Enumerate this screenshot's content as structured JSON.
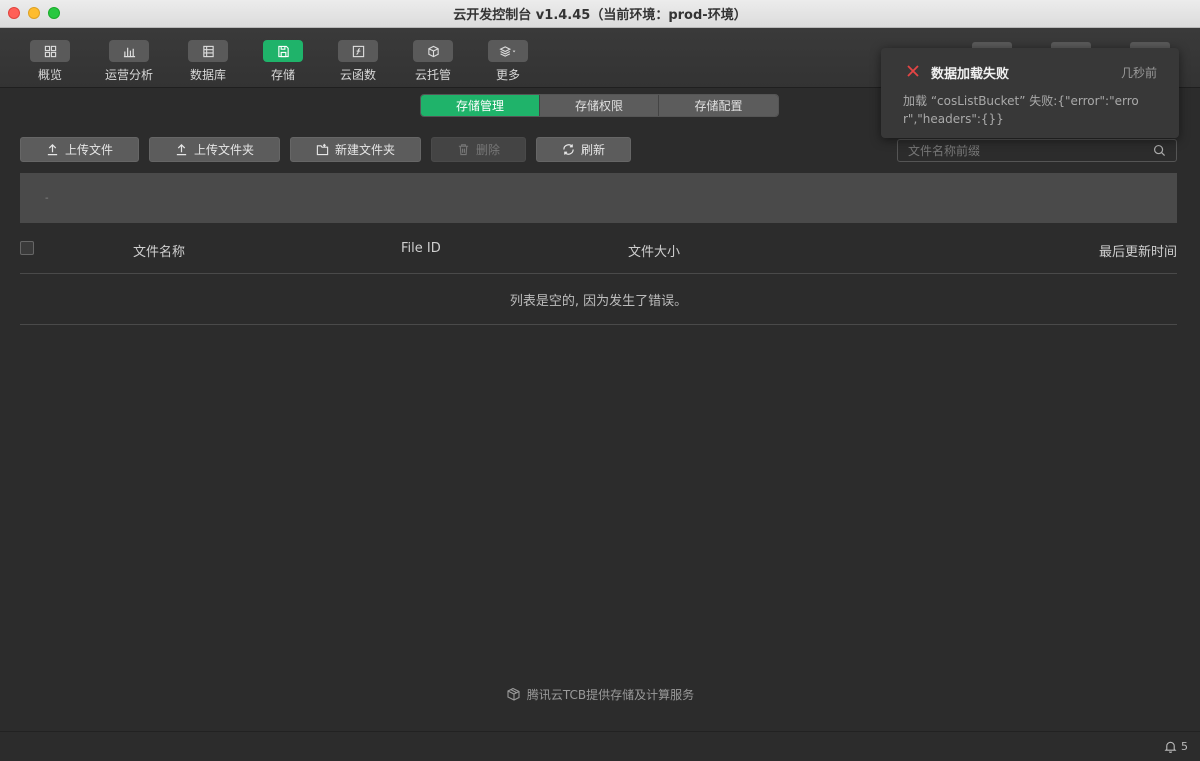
{
  "window": {
    "title": "云开发控制台 v1.4.45（当前环境：prod-环境）"
  },
  "toolbar": {
    "items": [
      {
        "label": "概览",
        "icon": "grid-icon"
      },
      {
        "label": "运营分析",
        "icon": "bar-chart-icon"
      },
      {
        "label": "数据库",
        "icon": "database-icon"
      },
      {
        "label": "存储",
        "icon": "storage-icon"
      },
      {
        "label": "云函数",
        "icon": "function-icon"
      },
      {
        "label": "云托管",
        "icon": "cube-icon"
      },
      {
        "label": "更多",
        "icon": "layers-icon"
      }
    ],
    "active": "存储"
  },
  "tabs": [
    {
      "label": "存储管理",
      "active": true
    },
    {
      "label": "存储权限",
      "active": false
    },
    {
      "label": "存储配置",
      "active": false
    }
  ],
  "actions": {
    "upload_file": "上传文件",
    "upload_folder": "上传文件夹",
    "new_folder": "新建文件夹",
    "delete": "删除",
    "refresh": "刷新"
  },
  "search": {
    "placeholder": "文件名称前缀",
    "value": ""
  },
  "path": {
    "text": "-"
  },
  "table": {
    "headers": {
      "name": "文件名称",
      "file_id": "File ID",
      "size": "文件大小",
      "updated": "最后更新时间"
    },
    "empty_message": "列表是空的, 因为发生了错误。"
  },
  "footer": {
    "text": "腾讯云TCB提供存储及计算服务"
  },
  "status": {
    "notification_count": "5"
  },
  "toast": {
    "title": "数据加载失败",
    "time": "几秒前",
    "message": "加载 “cosListBucket” 失败:{\"error\":\"error\",\"headers\":{}}"
  },
  "colors": {
    "accent": "#1fb36a",
    "error": "#e54545",
    "background": "#2c2c2c"
  }
}
